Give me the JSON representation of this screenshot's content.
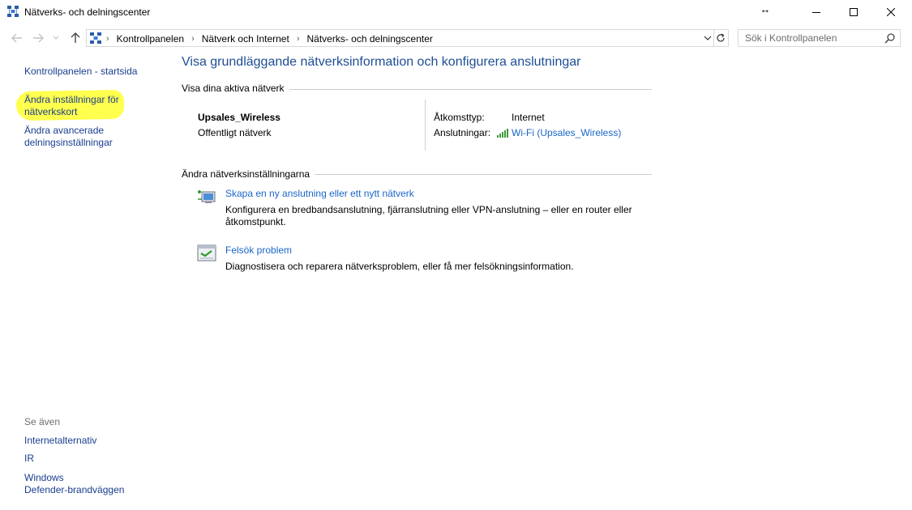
{
  "window": {
    "title": "Nätverks- och delningscenter"
  },
  "address": {
    "crumbs": [
      "Kontrollpanelen",
      "Nätverk och Internet",
      "Nätverks- och delningscenter"
    ],
    "search_placeholder": "Sök i Kontrollpanelen"
  },
  "sidebar": {
    "home_link": "Kontrollpanelen - startsida",
    "adapter_link_line1": "Ändra inställningar för",
    "adapter_link_line2": "nätverkskort",
    "advanced_link_line1": "Ändra avancerade",
    "advanced_link_line2": "delningsinställningar",
    "see_also": "Se även",
    "see_also_links": [
      "Internetalternativ",
      "IR"
    ],
    "firewall_line1": "Windows",
    "firewall_line2": "Defender-brandväggen",
    "highlight_color": "#ffff4d"
  },
  "main": {
    "title": "Visa grundläggande nätverksinformation och konfigurera anslutningar",
    "active_section": "Visa dina aktiva nätverk",
    "network_name": "Upsales_Wireless",
    "network_type": "Offentligt nätverk",
    "access_type_label": "Åtkomsttyp:",
    "access_type_value": "Internet",
    "connections_label": "Anslutningar:",
    "connection_link": "Wi-Fi (Upsales_Wireless)",
    "change_section": "Ändra nätverksinställningarna",
    "tasks": [
      {
        "icon": "new-connection-icon",
        "link": "Skapa en ny anslutning eller ett nytt nätverk",
        "desc_line1": "Konfigurera en bredbandsanslutning, fjärranslutning eller VPN-anslutning – eller en router eller",
        "desc_line2": "åtkomstpunkt."
      },
      {
        "icon": "troubleshoot-icon",
        "link": "Felsök problem",
        "desc_line1": "Diagnostisera och reparera nätverksproblem, eller få mer felsökningsinformation.",
        "desc_line2": ""
      }
    ]
  },
  "colors": {
    "link": "#1a66c8",
    "title_blue": "#1e4e94",
    "nav_link": "#1a3d8f"
  }
}
